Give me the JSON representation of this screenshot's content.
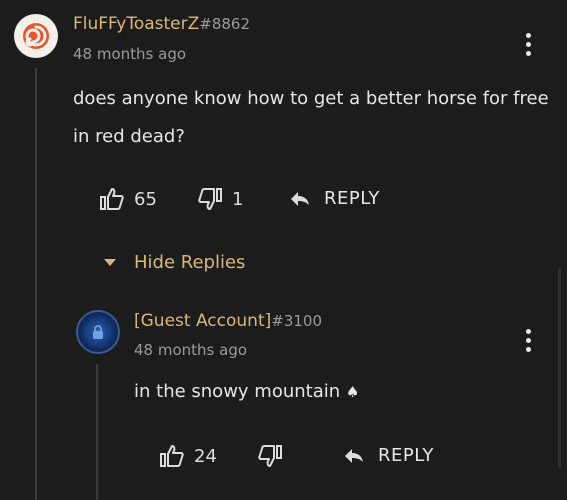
{
  "comment": {
    "username": "FluFFyToasterZ",
    "discriminator": "#8862",
    "timestamp": "48 months ago",
    "body_line1": "does anyone know how to get a better horse for free",
    "body_line2": "in red dead?",
    "likes": "65",
    "dislikes": "1",
    "reply_label": "REPLY",
    "hide_replies_label": "Hide Replies"
  },
  "reply": {
    "username": "[Guest Account]",
    "discriminator": "#3100",
    "timestamp": "48 months ago",
    "body": "in the snowy mountain",
    "body_emoji": "♠",
    "likes": "24",
    "reply_label": "REPLY"
  },
  "icons": {
    "like": "thumbs-up-icon",
    "dislike": "thumbs-down-icon",
    "reply": "reply-arrow-icon",
    "more": "more-vertical-icon",
    "collapse": "triangle-down-icon"
  },
  "colors": {
    "background": "#1c1c1c",
    "username": "#d9b77a",
    "muted": "#9a9a9a",
    "text": "#e6e6e6"
  }
}
